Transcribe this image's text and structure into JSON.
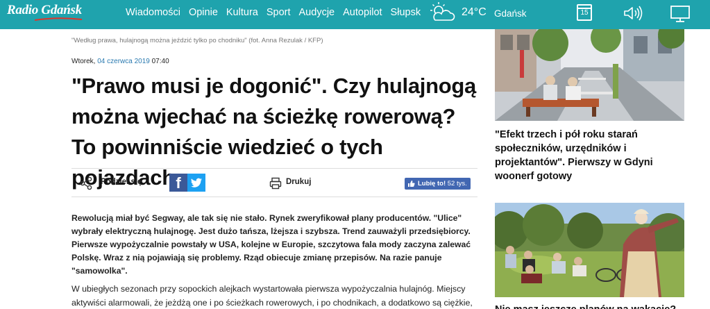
{
  "header": {
    "logo": "Radio Gdańsk",
    "nav": [
      "Wiadomości",
      "Opinie",
      "Kultura",
      "Sport",
      "Audycje",
      "Autopilot",
      "Słupsk"
    ],
    "weather": {
      "temperature": "24°C",
      "city": "Gdańsk",
      "icon": "partly-cloudy-icon"
    },
    "calendar_day": "15"
  },
  "article": {
    "caption": "\"Według prawa, hulajnogą można jeździć tylko po chodniku\" (fot. Anna Rezulak / KFP)",
    "date_weekday": "Wtorek, ",
    "date_link": "04 czerwca 2019",
    "date_time": " 07:40",
    "headline": "\"Prawo musi je dogonić\". Czy hulajnogą można wjechać na ścieżkę rowerową? To powinniście wiedzieć o tych pojazdach",
    "share_label": "Podziel się",
    "facebook_label": "f",
    "print_label": "Drukuj",
    "like_label": "Lubię to!",
    "like_count": "52 tys.",
    "lead": "Rewolucją miał być Segway, ale tak się nie stało. Rynek zweryfikował plany producentów. \"Ulice\" wybrały elektryczną hulajnogę. Jest dużo tańsza, lżejsza i szybsza. Trend zauważyli przedsiębiorcy. Pierwsze wypożyczalnie powstały w USA, kolejne w Europie, szczytowa fala mody zaczyna zalewać Polskę. Wraz z nią pojawiają się problemy. Rząd obiecuje zmianę przepisów. Na razie panuje \"samowolka\".",
    "body": "W ubiegłych sezonach przy sopockich alejkach wystartowała pierwsza wypożyczalnia hulajnóg. Miejscy aktywiści alarmowali, że jeżdżą one i po ścieżkach rowerowych, i po chodnikach, a dodatkowo są ciężkie, co"
  },
  "sidebar": {
    "related": [
      {
        "title": "\"Efekt trzech i pół roku starań społeczników, urzędników i projektantów\". Pierwszy w Gdyni woonerf gotowy"
      },
      {
        "title": "Nie masz jeszcze planów na wakacje?"
      }
    ]
  },
  "colors": {
    "brand": "#1fa3ad",
    "facebook": "#3b5998",
    "twitter": "#1da1f2",
    "link": "#2a7ab0"
  }
}
